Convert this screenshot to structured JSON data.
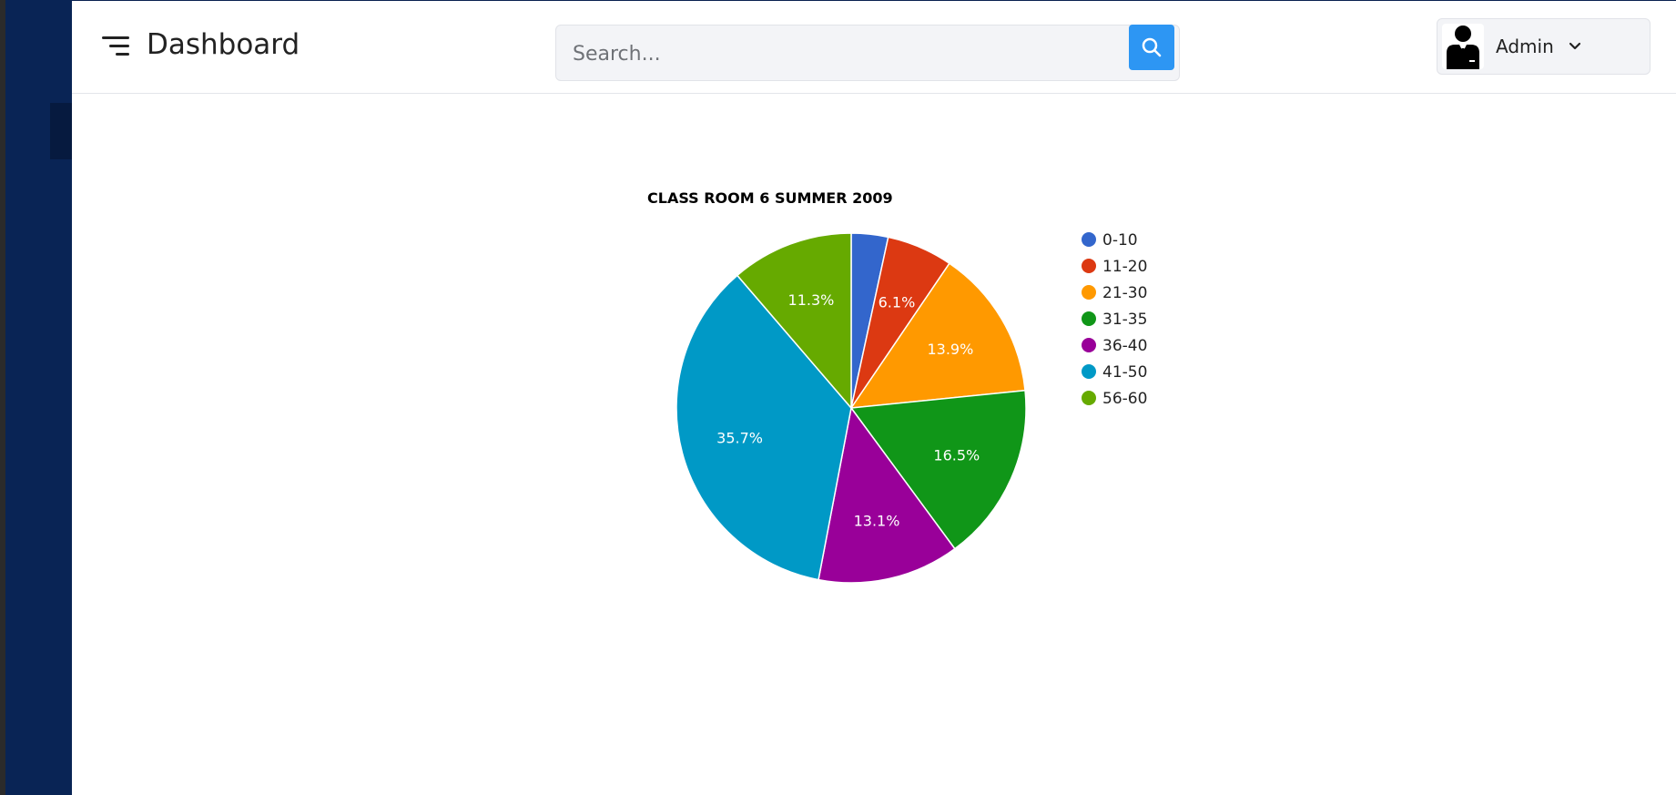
{
  "header": {
    "title": "Dashboard",
    "search_placeholder": "Search...",
    "user_name": "Admin"
  },
  "icons": {
    "menu": "menu-icon",
    "search": "search-icon",
    "avatar": "admin-avatar-icon",
    "dropdown": "chevron-down-icon"
  },
  "colors": {
    "sidebar": "#092455",
    "search_button": "#2d96f3"
  },
  "chart_data": {
    "type": "pie",
    "title": "CLASS ROOM 6 SUMMER 2009",
    "categories": [
      "0-10",
      "11-20",
      "21-30",
      "31-35",
      "36-40",
      "41-50",
      "56-60"
    ],
    "values": [
      3.4,
      6.1,
      13.9,
      16.5,
      13.1,
      35.7,
      11.3
    ],
    "labels": [
      "",
      "6.1%",
      "13.9%",
      "16.5%",
      "13.1%",
      "35.7%",
      "11.3%"
    ],
    "colors": [
      "#3366cc",
      "#dc3912",
      "#ff9900",
      "#109618",
      "#990099",
      "#0099c6",
      "#66aa00"
    ],
    "legend_position": "right"
  }
}
